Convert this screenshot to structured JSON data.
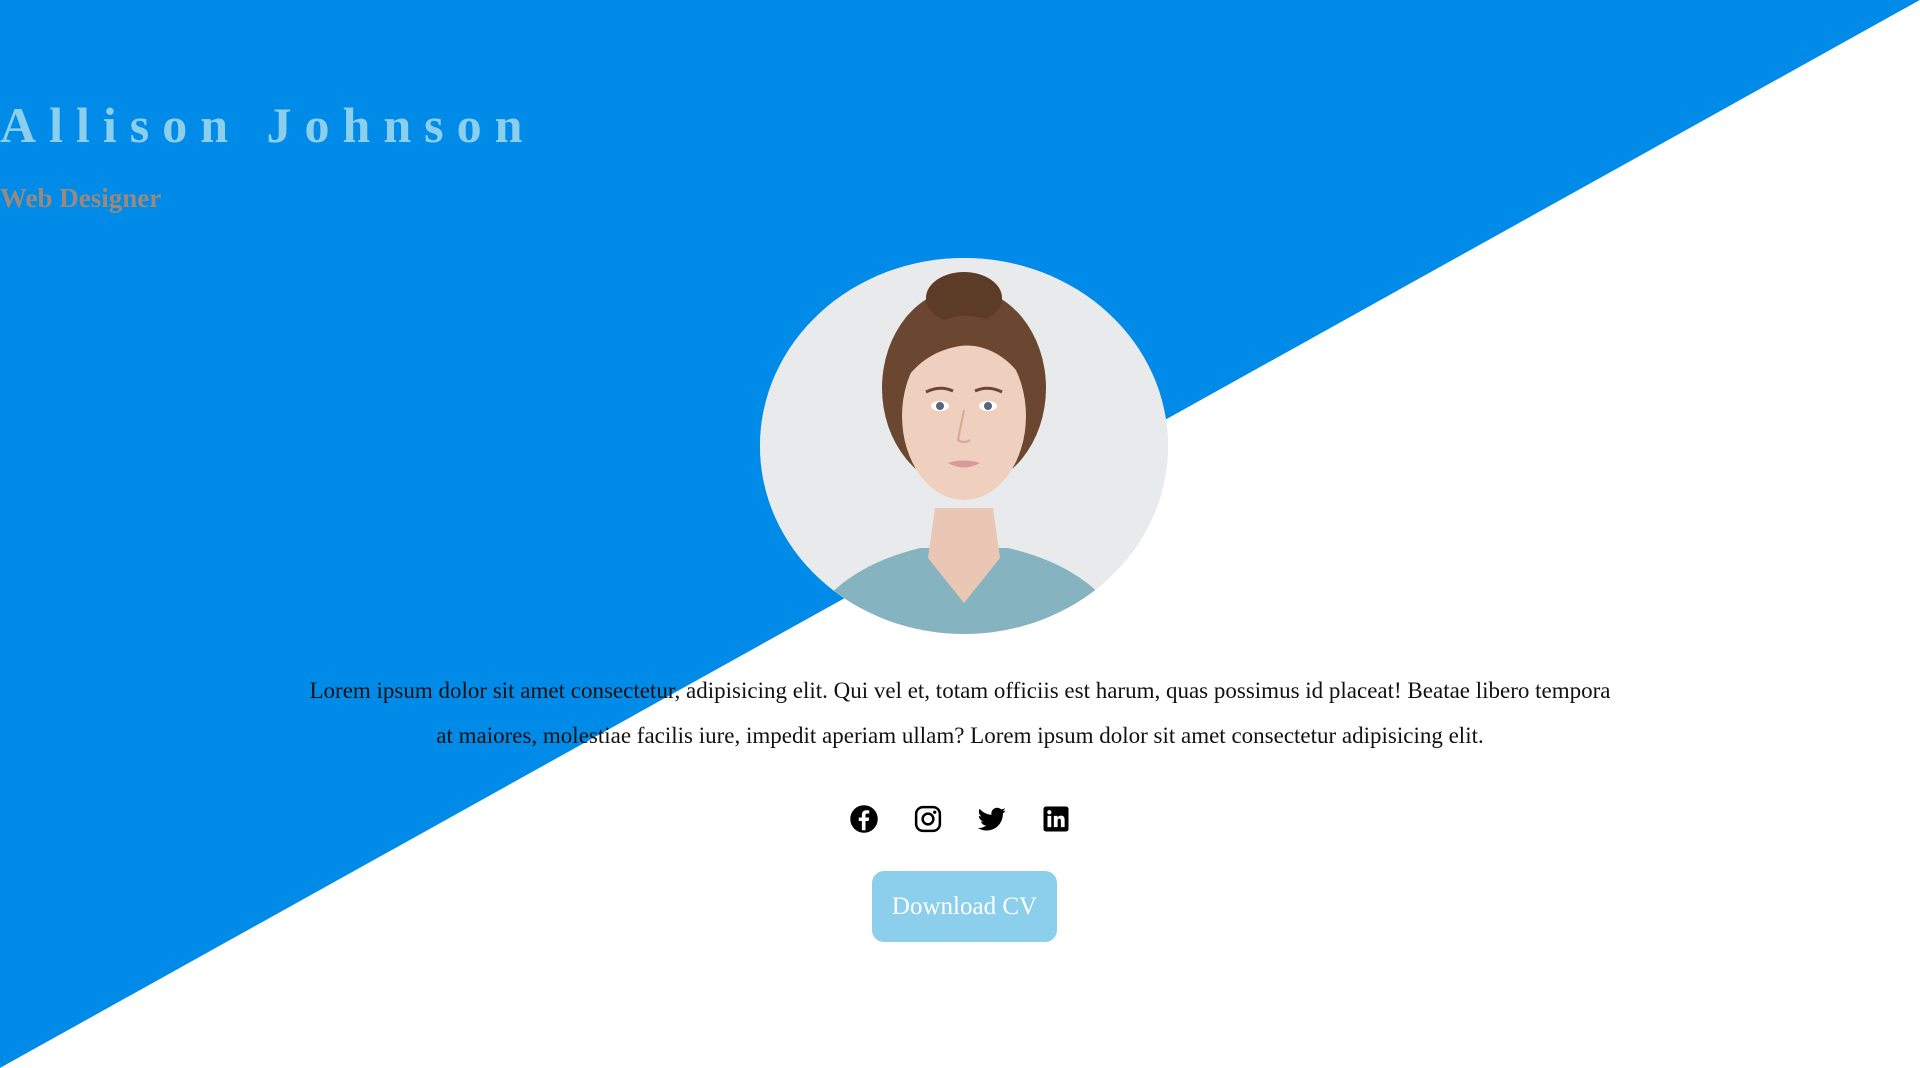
{
  "profile": {
    "name": "Allison Johnson",
    "role": "Web Designer",
    "bio": "Lorem ipsum dolor sit amet consectetur, adipisicing elit. Qui vel et, totam officiis est harum, quas possimus id placeat! Beatae libero tempora at maiores, molestiae facilis iure, impedit aperiam ullam? Lorem ipsum dolor sit amet consectetur adipisicing elit."
  },
  "socials": [
    {
      "icon": "facebook-icon"
    },
    {
      "icon": "instagram-icon"
    },
    {
      "icon": "twitter-icon"
    },
    {
      "icon": "linkedin-icon"
    }
  ],
  "cta": {
    "label": "Download CV"
  },
  "colors": {
    "primary_blue": "#008be9",
    "accent_light_blue": "#8ccfed",
    "role_text": "#9b8a7c",
    "background": "#ffffff"
  }
}
